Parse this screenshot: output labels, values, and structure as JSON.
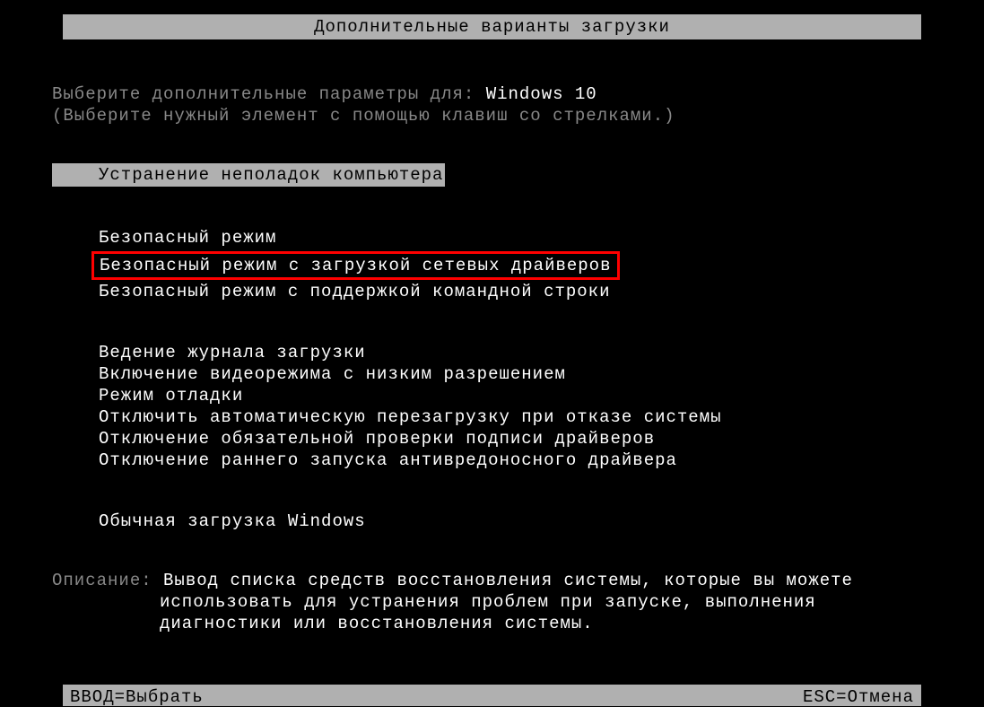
{
  "header": {
    "title": "Дополнительные варианты загрузки"
  },
  "prompt": {
    "line1_prefix": "Выберите дополнительные параметры для: ",
    "os_name": "Windows 10",
    "line2": "(Выберите нужный элемент с помощью клавиш со стрелками.)"
  },
  "selected_option": "Устранение неполадок компьютера",
  "menu_group1": {
    "item1": "Безопасный режим",
    "item2": "Безопасный режим с загрузкой сетевых драйверов",
    "item3": "Безопасный режим с поддержкой командной строки"
  },
  "menu_group2": {
    "item1": "Ведение журнала загрузки",
    "item2": "Включение видеорежима с низким разрешением",
    "item3": "Режим отладки",
    "item4": "Отключить автоматическую перезагрузку при отказе системы",
    "item5": "Отключение обязательной проверки подписи драйверов",
    "item6": "Отключение раннего запуска антивредоносного драйвера"
  },
  "menu_group3": {
    "item1": "Обычная загрузка Windows"
  },
  "description": {
    "label": "Описание: ",
    "line1": "Вывод списка средств восстановления системы, которые вы можете",
    "line2": "использовать для устранения проблем при запуске, выполнения",
    "line3": "диагностики или восстановления системы."
  },
  "footer": {
    "enter": "ВВОД=Выбрать",
    "esc": "ESC=Отмена"
  }
}
